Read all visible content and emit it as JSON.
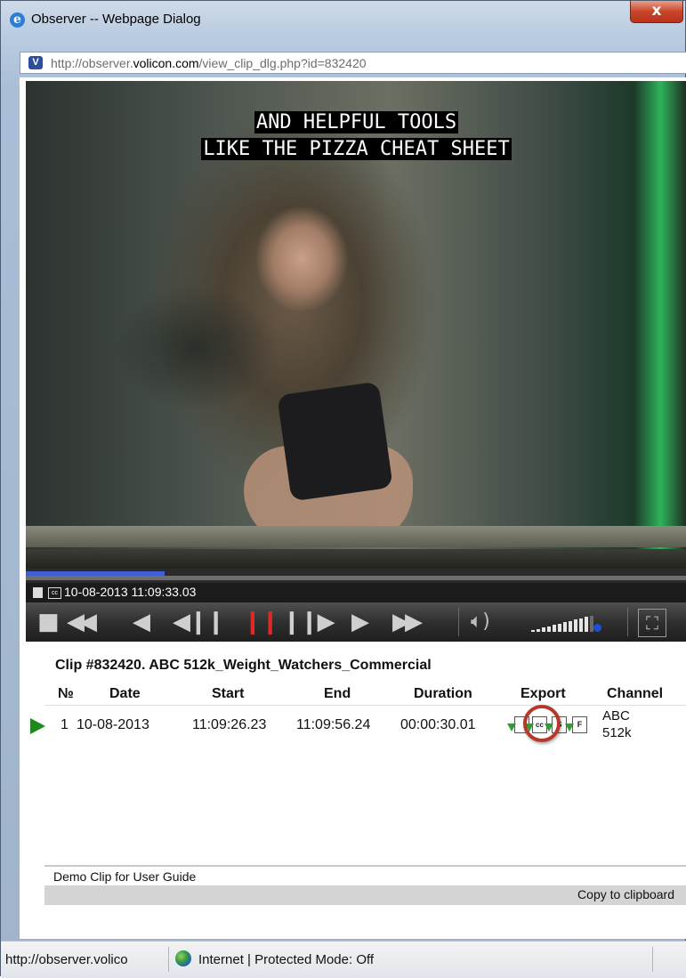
{
  "window": {
    "title": "Observer -- Webpage Dialog",
    "close_glyph": "x"
  },
  "address": {
    "url_prefix": "http://observer.",
    "url_domain": "volicon.com",
    "url_suffix": "/view_clip_dlg.php?id=832420"
  },
  "player": {
    "caption_line1": "AND HELPFUL TOOLS",
    "caption_line2": "LIKE THE PIZZA CHEAT SHEET",
    "timestamp": "10-08-2013 11:09:33.03",
    "progress_fraction": 0.21,
    "volume_level": 0.9
  },
  "clip": {
    "title": "Clip #832420. ABC 512k_Weight_Watchers_Commercial",
    "columns": {
      "no": "№",
      "date": "Date",
      "start": "Start",
      "end": "End",
      "duration": "Duration",
      "export": "Export",
      "channel": "Channel"
    },
    "rows": [
      {
        "no": "1",
        "date": "10-08-2013",
        "start": "11:09:26.23",
        "end": "11:09:56.24",
        "duration": "00:00:30.01",
        "channel_line1": "ABC",
        "channel_line2": "512k"
      }
    ],
    "export_icons": [
      "cc-export-icon",
      "subtitle-export-icon",
      "format-export-icon"
    ],
    "note": "Demo Clip for User Guide",
    "copy_label": "Copy to clipboard"
  },
  "status": {
    "url": "http://observer.volico",
    "zone": "Internet | Protected Mode: Off"
  },
  "colors": {
    "highlight_ring": "#b6382b",
    "play_arrow": "#1d8a1d",
    "pause_button": "#e12828",
    "progress_fill": "#3f5ed9"
  }
}
